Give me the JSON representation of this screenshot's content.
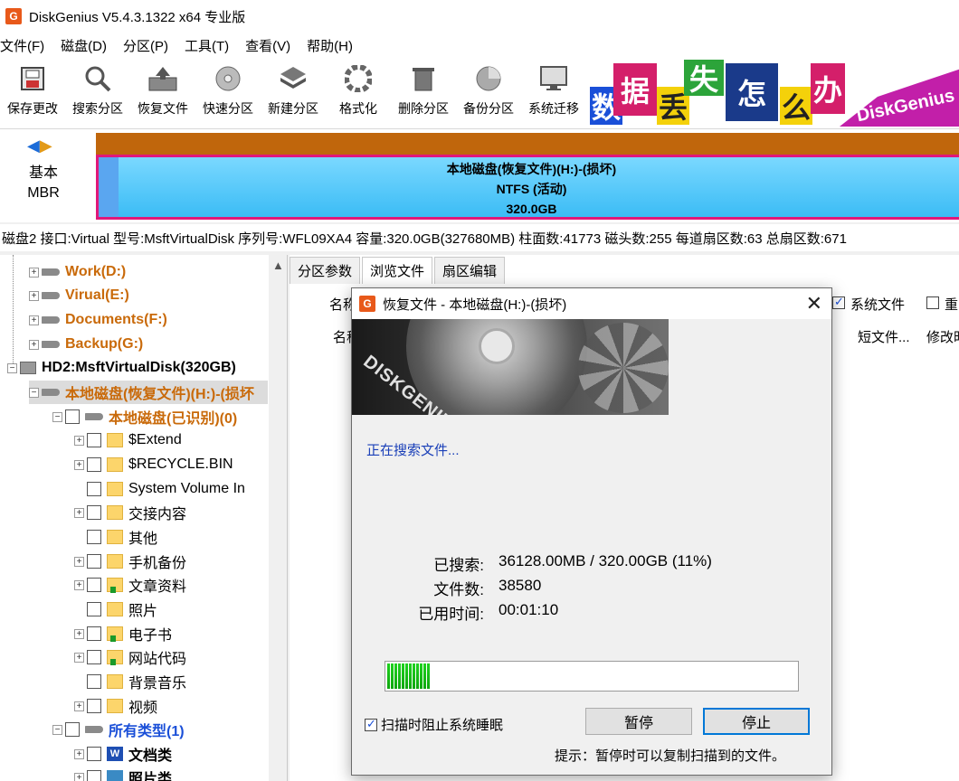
{
  "app": {
    "logo_glyph": "G",
    "title": "DiskGenius V5.4.3.1322 x64 专业版"
  },
  "menu": [
    "文件(F)",
    "磁盘(D)",
    "分区(P)",
    "工具(T)",
    "查看(V)",
    "帮助(H)"
  ],
  "toolbar": [
    {
      "label": "保存更改",
      "icon": "save-icon"
    },
    {
      "label": "搜索分区",
      "icon": "search-icon"
    },
    {
      "label": "恢复文件",
      "icon": "recover-icon"
    },
    {
      "label": "快速分区",
      "icon": "quick-partition-icon"
    },
    {
      "label": "新建分区",
      "icon": "new-partition-icon"
    },
    {
      "label": "格式化",
      "icon": "format-icon"
    },
    {
      "label": "删除分区",
      "icon": "delete-icon"
    },
    {
      "label": "备份分区",
      "icon": "backup-icon"
    },
    {
      "label": "系统迁移",
      "icon": "migrate-icon"
    }
  ],
  "banner": {
    "chars": [
      "数",
      "据",
      "丢",
      "失",
      "怎",
      "么",
      "办"
    ],
    "brand": "DiskGenius"
  },
  "diskmap": {
    "type_line1": "基本",
    "type_line2": "MBR",
    "partition_name": "本地磁盘(恢复文件)(H:)-(损坏)",
    "partition_fs": "NTFS (活动)",
    "partition_size": "320.0GB"
  },
  "diskinfo": "磁盘2 接口:Virtual  型号:MsftVirtualDisk  序列号:WFL09XA4  容量:320.0GB(327680MB)  柱面数:41773  磁头数:255  每道扇区数:63  总扇区数:671",
  "tree": {
    "drives": [
      "Work(D:)",
      "Virual(E:)",
      "Documents(F:)",
      "Backup(G:)"
    ],
    "hd2": "HD2:MsftVirtualDisk(320GB)",
    "partition": "本地磁盘(恢复文件)(H:)-(损坏",
    "identified": "本地磁盘(已识别)(0)",
    "folders": [
      "$Extend",
      "$RECYCLE.BIN",
      "System Volume In",
      "交接内容",
      "其他",
      "手机备份",
      "文章资料",
      "照片",
      "电子书",
      "网站代码",
      "背景音乐",
      "视频"
    ],
    "all_types": "所有类型(1)",
    "type_doc": "文档类",
    "type_pic": "照片类"
  },
  "tabs": [
    "分区参数",
    "浏览文件",
    "扇区编辑"
  ],
  "right": {
    "filter_name_label": "名称",
    "system_files_label": "系统文件",
    "extra_label": "重",
    "col_name": "名称",
    "col_short": "短文件...",
    "col_modified": "修改时"
  },
  "dialog": {
    "title": "恢复文件 - 本地磁盘(H:)-(损坏)",
    "banner_text": "DISKGENIUS",
    "status": "正在搜索文件...",
    "searched_label": "已搜索:",
    "searched_value": "36128.00MB / 320.00GB (11%)",
    "files_label": "文件数:",
    "files_value": "38580",
    "elapsed_label": "已用时间:",
    "elapsed_value": "00:01:10",
    "progress": 0.11,
    "prevent_sleep_label": "扫描时阻止系统睡眠",
    "pause_label": "暂停",
    "stop_label": "停止",
    "hint": "提示：暂停时可以复制扫描到的文件。"
  },
  "colors": {
    "accent_orange": "#c96a0a",
    "partition_blue": "#3bbcf5",
    "partition_border": "#e0187a",
    "progress_green": "#1ed21e",
    "link_blue": "#1a4fd8"
  }
}
